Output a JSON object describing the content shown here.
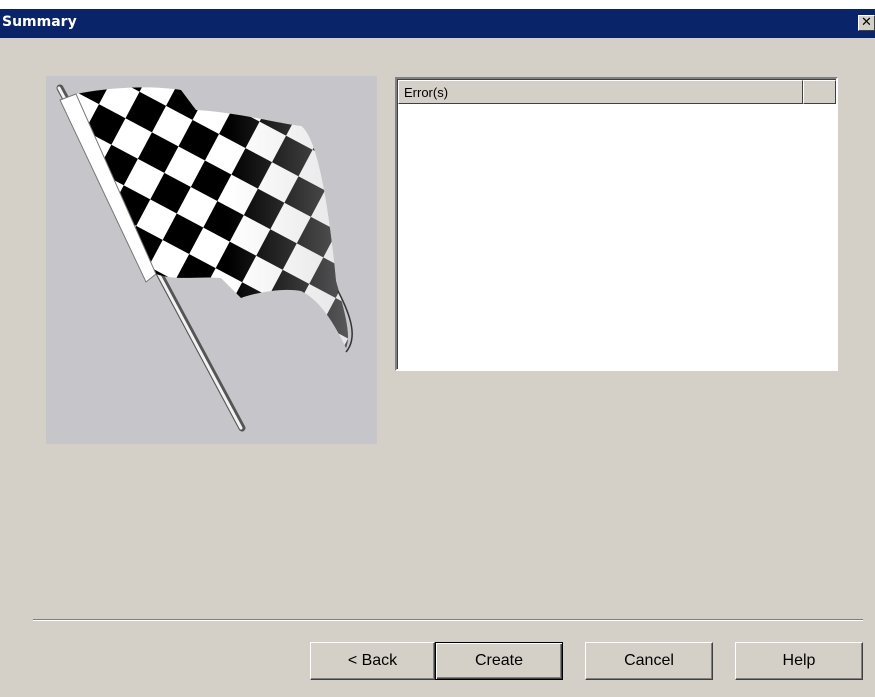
{
  "window": {
    "title": "Summary",
    "close_label": "✕"
  },
  "image": {
    "icon": "checkered-flag-icon"
  },
  "errors_list": {
    "columns": [
      "Error(s)",
      ""
    ],
    "rows": []
  },
  "buttons": {
    "back": "< Back",
    "create": "Create",
    "cancel": "Cancel",
    "help": "Help"
  }
}
